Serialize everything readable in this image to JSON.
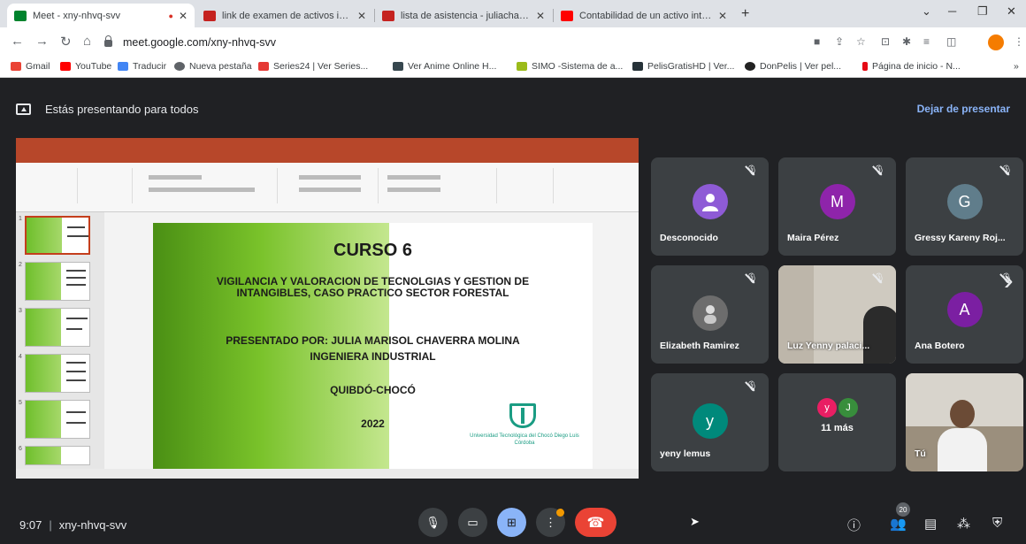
{
  "browser": {
    "tabs": [
      {
        "title": "Meet - xny-nhvq-svv",
        "favicon_color": "#00832d"
      },
      {
        "title": "link de examen de activos intang",
        "favicon_color": "#c5221f"
      },
      {
        "title": "lista de asistencia - juliachaverra",
        "favicon_color": "#c5221f"
      },
      {
        "title": "Contabilidad de un activo intang",
        "favicon_color": "#ff0000"
      }
    ],
    "new_tab": "+",
    "url": "meet.google.com/xny-nhvq-svv",
    "bookmarks": [
      {
        "label": "Gmail",
        "color": "#ea4335"
      },
      {
        "label": "YouTube",
        "color": "#ff0000"
      },
      {
        "label": "Traducir",
        "color": "#4285f4"
      },
      {
        "label": "Nueva pestaña",
        "color": "#5f6368"
      },
      {
        "label": "Series24 | Ver Series...",
        "color": "#e53935"
      },
      {
        "label": "Ver Anime Online H...",
        "color": "#37474f"
      },
      {
        "label": "SIMO -Sistema de a...",
        "color": "#9bbb1a"
      },
      {
        "label": "PelisGratisHD | Ver...",
        "color": "#263238"
      },
      {
        "label": "DonPelis | Ver pel...",
        "color": "#222222"
      },
      {
        "label": "Página de inicio - N...",
        "color": "#e50914"
      }
    ]
  },
  "meet": {
    "presenting_banner": "Estás presentando para todos",
    "stop_presenting": "Dejar de presentar",
    "time": "9:07",
    "meeting_code": "xny-nhvq-svv",
    "participants_count": "20",
    "participants": [
      {
        "name": "Desconocido",
        "initial": "",
        "color": "#8e5bd6",
        "muted": true
      },
      {
        "name": "Maira Pérez",
        "initial": "M",
        "color": "#8e24aa",
        "muted": true
      },
      {
        "name": "Gressy Kareny Roj...",
        "initial": "G",
        "color": "#607d8b",
        "muted": true
      },
      {
        "name": "Elizabeth Ramirez",
        "initial": "",
        "color": "#6d6d6d",
        "muted": true
      },
      {
        "name": "Luz Yenny palaci...",
        "initial": "",
        "color": "#cfcac0",
        "muted": true
      },
      {
        "name": "Ana Botero",
        "initial": "A",
        "color": "#7b1fa2",
        "muted": true
      },
      {
        "name": "yeny lemus",
        "initial": "y",
        "color": "#00897b",
        "muted": true
      },
      {
        "name": "11 más",
        "initial": "y",
        "color": "#e91e63",
        "muted": false
      },
      {
        "name": "Tú",
        "initial": "",
        "color": "#9b8f7d",
        "muted": false
      }
    ],
    "more_avatar_2": "J"
  },
  "slide": {
    "course": "CURSO 6",
    "title": "VIGILANCIA Y VALORACION DE TECNOLGIAS Y GESTION DE INTANGIBLES, CASO PRACTICO SECTOR FORESTAL",
    "presented_by": "PRESENTADO POR: JULIA MARISOL CHAVERRA MOLINA",
    "role": "INGENIERA INDUSTRIAL",
    "place": "QUIBDÓ-CHOCÓ",
    "year": "2022",
    "university": "Universidad Tecnológica del Chocó Diego Luis Córdoba"
  }
}
